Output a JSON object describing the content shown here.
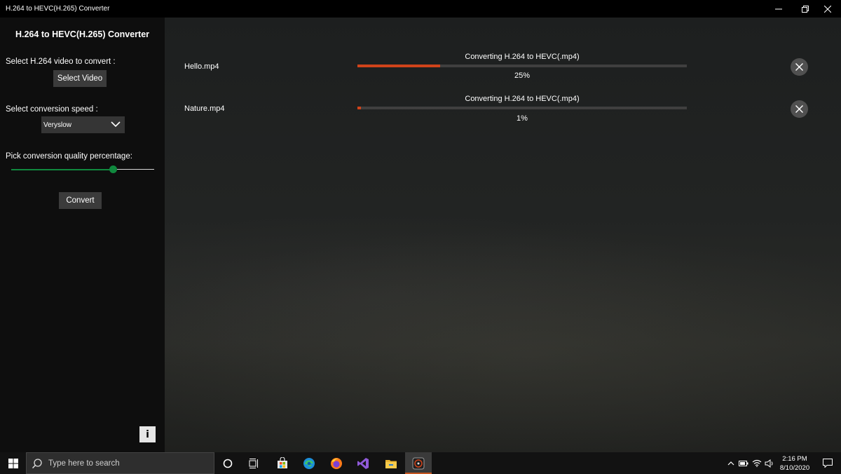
{
  "window": {
    "title": "H.264 to HEVC(H.265) Converter",
    "controls": [
      "minimize-icon",
      "restore-icon",
      "close-icon"
    ]
  },
  "sidebar": {
    "heading": "H.264 to HEVC(H.265) Converter",
    "select_video_label": "Select H.264 video to convert :",
    "select_video_button": "Select Video",
    "speed_label": "Select conversion speed :",
    "speed_selected": "Veryslow",
    "quality_label": "Pick conversion quality percentage:",
    "quality_value": 0.71,
    "convert_button": "Convert",
    "info_button": "i"
  },
  "jobs": [
    {
      "file": "Hello.mp4",
      "status": "Converting H.264 to HEVC(.mp4)",
      "progress": 25,
      "percent_text": "25%"
    },
    {
      "file": "Nature.mp4",
      "status": "Converting H.264 to HEVC(.mp4)",
      "progress": 1,
      "percent_text": "1%"
    }
  ],
  "taskbar": {
    "search_placeholder": "Type here to search",
    "pinned": [
      "cortana-icon",
      "task-view-icon",
      "store-icon",
      "edge-icon",
      "firefox-icon",
      "visual-studio-icon",
      "file-explorer-icon",
      "converter-app-icon"
    ],
    "tray": [
      "chevron-up-icon",
      "battery-icon",
      "wifi-icon",
      "volume-icon"
    ],
    "time": "2:16 PM",
    "date": "8/10/2020"
  },
  "colors": {
    "accent_progress": "#d0431a",
    "slider_green": "#10893e",
    "sidebar_bg": "#0e0e0e"
  }
}
